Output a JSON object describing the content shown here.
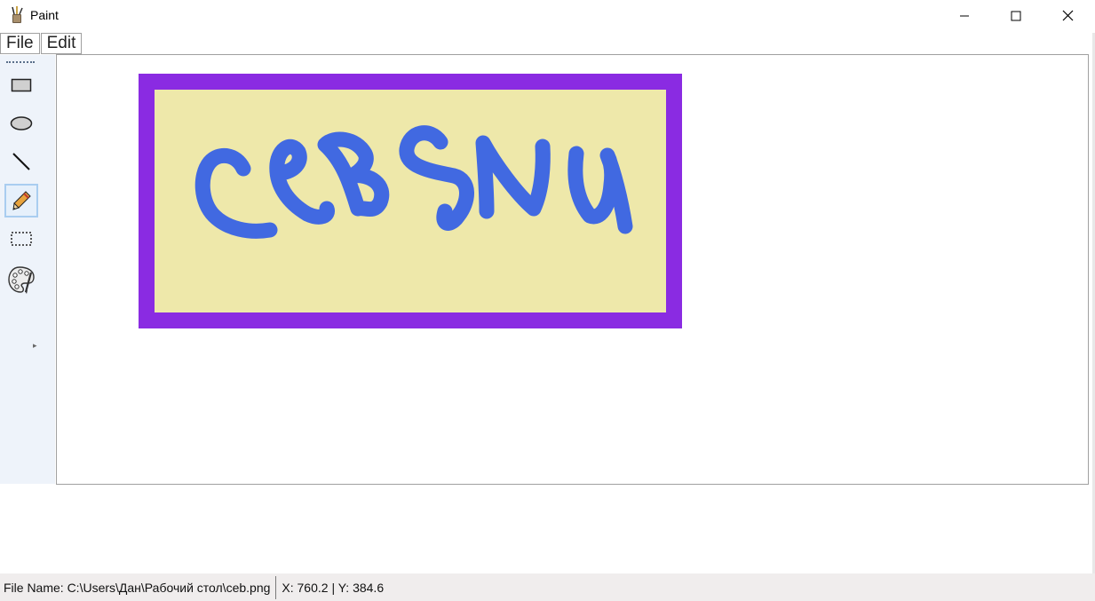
{
  "window": {
    "title": "Paint"
  },
  "menu": {
    "file": "File",
    "edit": "Edit"
  },
  "tools": [
    {
      "name": "rectangle",
      "icon": "rectangle-icon",
      "active": false
    },
    {
      "name": "ellipse",
      "icon": "ellipse-icon",
      "active": false
    },
    {
      "name": "line",
      "icon": "line-icon",
      "active": false
    },
    {
      "name": "pencil",
      "icon": "pencil-icon",
      "active": true
    },
    {
      "name": "selection",
      "icon": "dashed-rectangle-icon",
      "active": false
    },
    {
      "name": "palette",
      "icon": "palette-icon",
      "active": false
    }
  ],
  "drawing": {
    "text": "ceBSNu",
    "border_color": "#8a2be2",
    "fill_color": "#eee8aa",
    "stroke_color": "#4169e1"
  },
  "status": {
    "file_name": "File Name: C:\\Users\\Дан\\Рабочий стол\\ceb.png",
    "coords": "X: 760.2 | Y: 384.6"
  }
}
